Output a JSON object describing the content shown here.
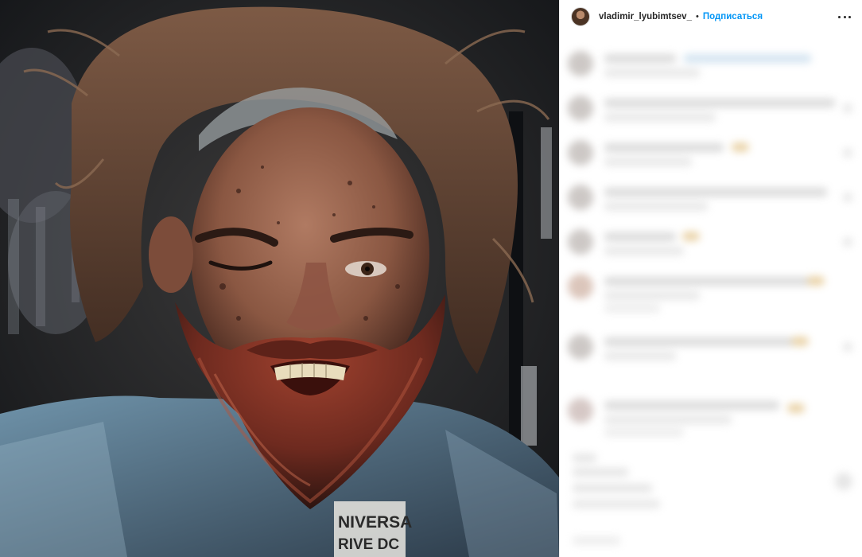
{
  "photo": {
    "alt": "portrait",
    "jacket_text_line1": "NIVERSA",
    "jacket_text_line2": "RIVE DC"
  },
  "header": {
    "username": "vladimir_lyubimtsev_",
    "separator": "•",
    "follow_label": "Подписаться",
    "more_icon": "more-horizontal-icon"
  },
  "comments_blurred": true
}
